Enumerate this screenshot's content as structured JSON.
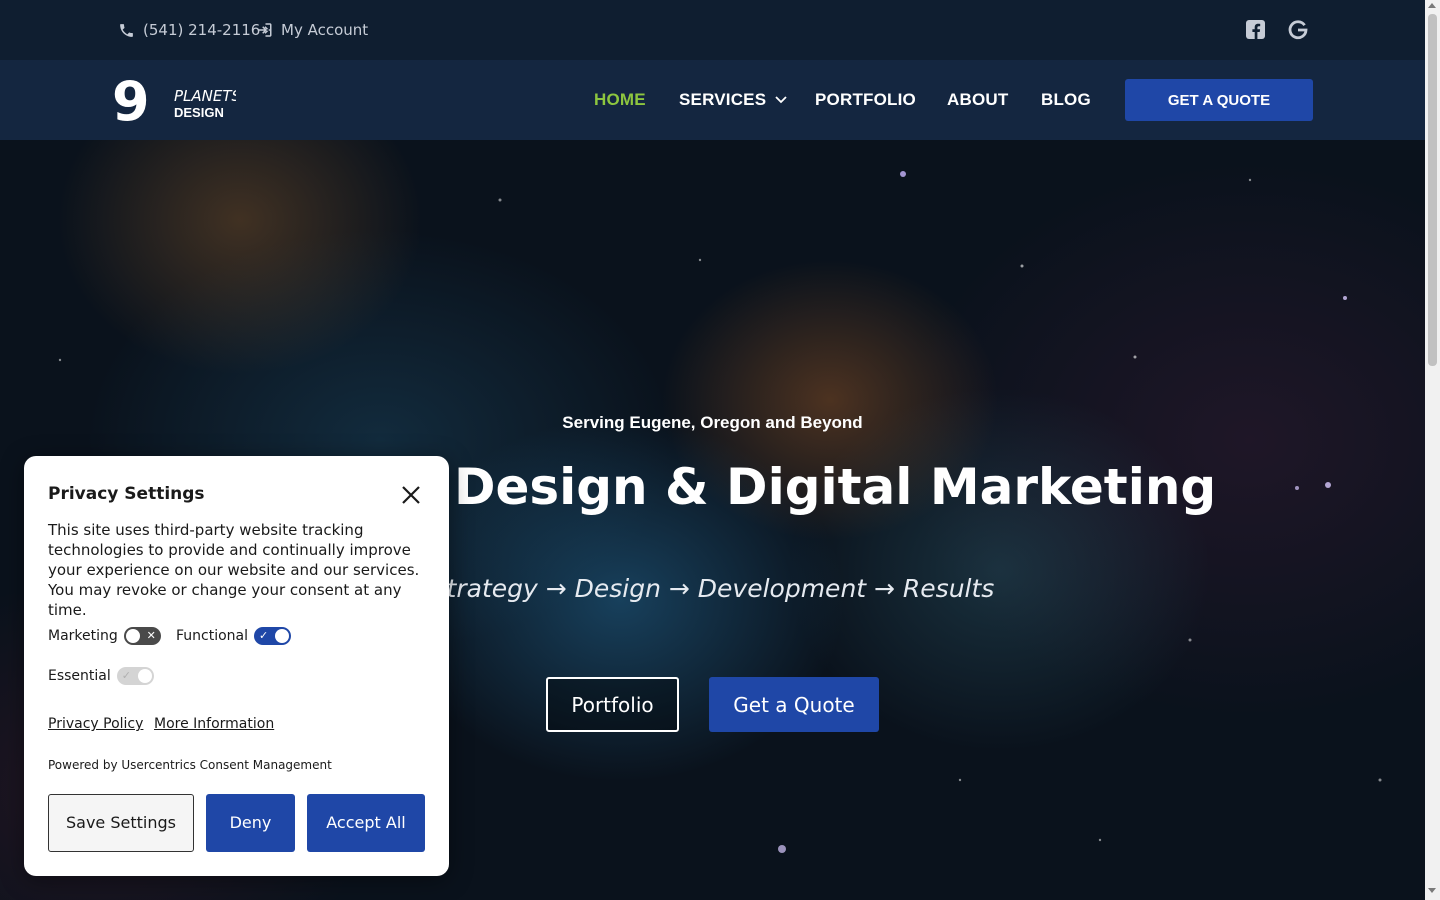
{
  "topbar": {
    "phone": "(541) 214-2116",
    "account_label": "My Account",
    "social": [
      "facebook-icon",
      "google-icon"
    ]
  },
  "nav": {
    "logo_mark": "9",
    "logo_line1": "PLANETS",
    "logo_line2": "DESIGN",
    "items": [
      {
        "label": "HOME",
        "active": true
      },
      {
        "label": "SERVICES",
        "has_dropdown": true
      },
      {
        "label": "PORTFOLIO"
      },
      {
        "label": "ABOUT"
      },
      {
        "label": "BLOG"
      }
    ],
    "cta_label": "GET A QUOTE"
  },
  "hero": {
    "tagline": "Serving Eugene, Oregon and Beyond",
    "title": "Website Design & Digital Marketing",
    "subtitle": "Strategy → Design → Development → Results",
    "btn_portfolio": "Portfolio",
    "btn_quote": "Get a Quote"
  },
  "privacy": {
    "title": "Privacy Settings",
    "text": "This site uses third-party website tracking technologies to provide and continually improve your experience on our website and our services. You may revoke or change your consent at any time.",
    "toggles": [
      {
        "label": "Marketing",
        "state": "off"
      },
      {
        "label": "Functional",
        "state": "on"
      },
      {
        "label": "Essential",
        "state": "on-disabled"
      }
    ],
    "link_policy": "Privacy Policy",
    "link_more": "More Information",
    "powered_by": "Powered by Usercentrics Consent Management",
    "btn_save": "Save Settings",
    "btn_deny": "Deny",
    "btn_accept": "Accept All"
  },
  "colors": {
    "topbar_bg": "#0f1e30",
    "navbar_bg": "#142640",
    "accent_blue": "#1f47a7",
    "active_green": "#8dc63f"
  }
}
